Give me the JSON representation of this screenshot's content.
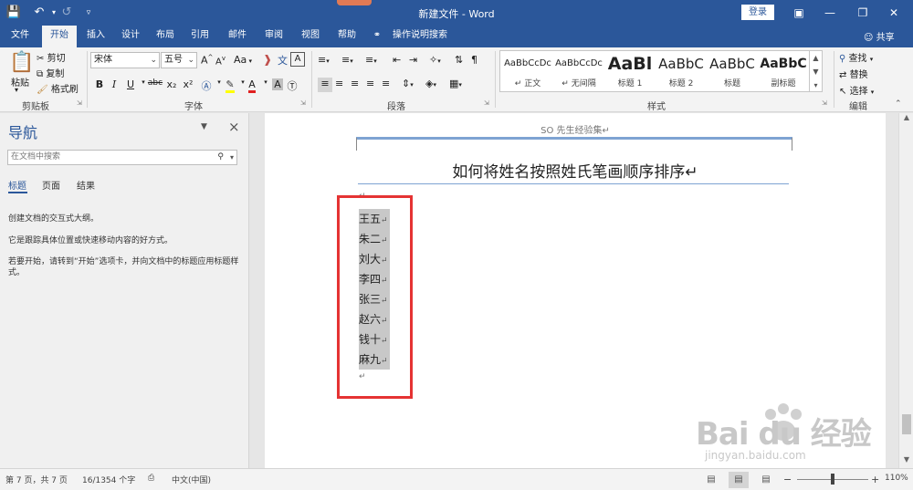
{
  "titlebar": {
    "doc_title": "新建文件 - Word",
    "login_label": "登录",
    "icons": [
      "save-icon",
      "undo-icon",
      "redo-icon",
      "customize-icon",
      "ribbon-display-icon",
      "minimize-icon",
      "restore-icon",
      "close-icon"
    ]
  },
  "tabs": {
    "file": "文件",
    "home": "开始",
    "insert": "插入",
    "design": "设计",
    "layout": "布局",
    "references": "引用",
    "mailings": "邮件",
    "review": "审阅",
    "view": "视图",
    "help": "帮助",
    "tell_me": "操作说明搜索",
    "share": "共享"
  },
  "ribbon": {
    "clipboard": {
      "paste": "粘贴",
      "cut": "剪切",
      "copy": "复制",
      "format_painter": "格式刷",
      "group_label": "剪贴板"
    },
    "font": {
      "font_name": "宋体",
      "font_size": "五号",
      "grow": "A",
      "shrink": "A",
      "change_case": "Aa",
      "bold": "B",
      "italic": "I",
      "underline": "U",
      "strikethrough": "abc",
      "subscript": "x₂",
      "superscript": "x²",
      "font_color": "A",
      "group_label": "字体"
    },
    "paragraph": {
      "group_label": "段落"
    },
    "styles": {
      "items": [
        {
          "sample": "AaBbCcDc",
          "name": "正文"
        },
        {
          "sample": "AaBbCcDc",
          "name": "无间隔"
        },
        {
          "sample": "AaBl",
          "name": "标题 1"
        },
        {
          "sample": "AaBbC",
          "name": "标题 2"
        },
        {
          "sample": "AaBbC",
          "name": "标题"
        },
        {
          "sample": "AaBbC",
          "name": "副标题"
        }
      ],
      "group_label": "样式"
    },
    "editing": {
      "find": "查找",
      "replace": "替换",
      "select": "选择",
      "group_label": "编辑"
    }
  },
  "navigation": {
    "title": "导航",
    "search_placeholder": "在文档中搜索",
    "tabs": [
      "标题",
      "页面",
      "结果"
    ],
    "text1": "创建文档的交互式大纲。",
    "text2": "它是跟踪具体位置或快速移动内容的好方式。",
    "text3": "若要开始，请转到“开始”选项卡，并向文档中的标题应用标题样式。"
  },
  "document": {
    "header_text": "SO 先生经验集↵",
    "heading": "如何将姓名按照姓氏笔画顺序排序↵",
    "para_mark": "↵",
    "names": [
      "王五",
      "朱二",
      "刘大",
      "李四",
      "张三",
      "赵六",
      "钱十",
      "麻九"
    ],
    "name_mark": "↵"
  },
  "statusbar": {
    "page": "第 7 页，共 7 页",
    "words": "16/1354 个字",
    "language": "中文(中国)",
    "zoom": "110%"
  },
  "watermark": {
    "brand": "Bai du 经验",
    "url": "jingyan.baidu.com"
  },
  "colors": {
    "accent": "#2b579a",
    "highlight_frame": "#e53333",
    "selection": "#c8c8c8"
  }
}
